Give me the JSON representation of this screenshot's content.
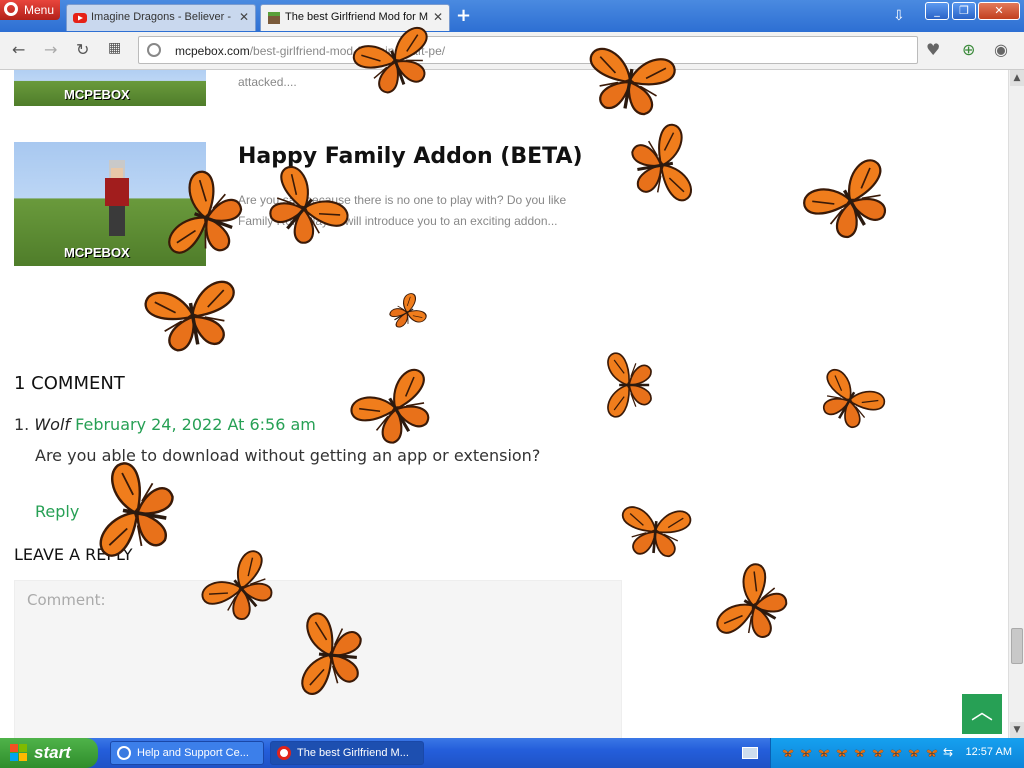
{
  "browser": {
    "menu_label": "Menu",
    "tabs": [
      {
        "label": "Imagine Dragons - Believer - ",
        "active": false
      },
      {
        "label": "The best Girlfriend Mod for M",
        "active": true
      }
    ],
    "url_host": "mcpebox.com",
    "url_path": "/best-girlfriend-mod-for-minecraft-pe/"
  },
  "page": {
    "prev_snippet": "attacked....",
    "post": {
      "title": "Happy Family Addon (BETA)",
      "snippet_line1": "Are you sad because there is no one to play with? Do you like",
      "snippet_line2": "Family Role Play? I will introduce you to an exciting addon..."
    },
    "thumb_label": "MCPEBOX",
    "comments_heading": "1 COMMENT",
    "comment": {
      "number": "1.",
      "author": "Wolf",
      "date": "February 24, 2022 At 6:56 am",
      "body": "Are you able to download without getting an app or extension?",
      "reply_label": "Reply"
    },
    "leave_reply_heading": "LEAVE A REPLY",
    "comment_placeholder": "Comment:",
    "to_top_icon": "chevron-up-icon"
  },
  "taskbar": {
    "start_label": "start",
    "tasks": [
      {
        "label": "Help and Support Ce...",
        "active": false
      },
      {
        "label": "The best Girlfriend M...",
        "active": true
      }
    ],
    "clock": "12:57 AM"
  },
  "colors": {
    "accent_green": "#27a055",
    "butterfly_orange": "#f07d1c",
    "xp_blue": "#245edb"
  }
}
